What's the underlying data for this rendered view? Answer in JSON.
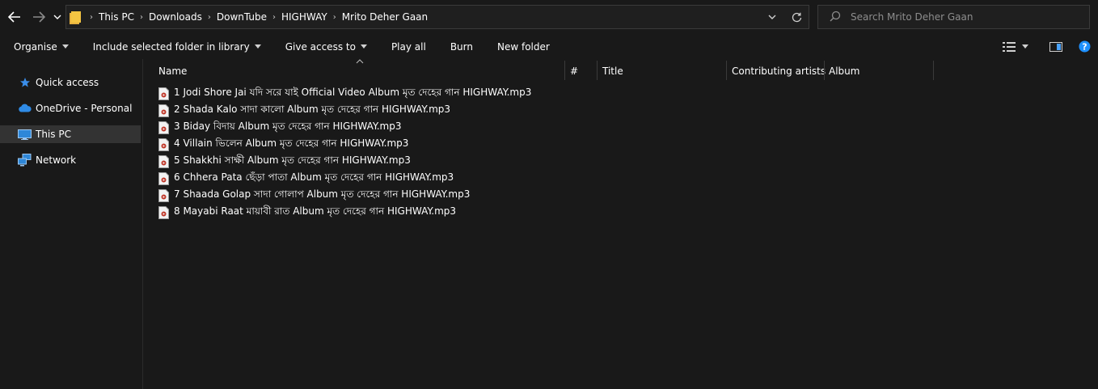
{
  "breadcrumb": [
    "This PC",
    "Downloads",
    "DownTube",
    "HIGHWAY",
    "Mrito Deher Gaan"
  ],
  "search": {
    "placeholder": "Search Mrito Deher Gaan"
  },
  "toolbar": {
    "organise": "Organise",
    "include_library": "Include selected folder in library",
    "give_access": "Give access to",
    "play_all": "Play all",
    "burn": "Burn",
    "new_folder": "New folder"
  },
  "navpane": {
    "items": [
      {
        "label": "Quick access",
        "icon": "star-icon"
      },
      {
        "label": "OneDrive - Personal",
        "icon": "cloud-icon"
      },
      {
        "label": "This PC",
        "icon": "computer-icon",
        "selected": true
      },
      {
        "label": "Network",
        "icon": "network-icon"
      }
    ]
  },
  "columns": [
    "Name",
    "#",
    "Title",
    "Contributing artists",
    "Album"
  ],
  "files": [
    "1 Jodi Shore Jai  যদি সরে যাই  Official Video  Album মৃত দেহের গান  HIGHWAY.mp3",
    "2 Shada Kalo সাদা কালো  Album মৃত দেহের গান  HIGHWAY.mp3",
    "3 Biday বিদায়  Album মৃত দেহের গান  HIGHWAY.mp3",
    "4 Villain ভিলেন  Album মৃত দেহের গান  HIGHWAY.mp3",
    "5 Shakkhi সাক্ষী  Album মৃত দেহের গান  HIGHWAY.mp3",
    "6 Chhera Pata ছেঁড়া পাতা  Album মৃত দেহের গান  HIGHWAY.mp3",
    "7 Shaada Golap সাদা গোলাপ  Album মৃত দেহের গান  HIGHWAY.mp3",
    "8 Mayabi Raat মায়াবী রাত  Album মৃত দেহের গান  HIGHWAY.mp3"
  ],
  "colors": {
    "background": "#191919",
    "selected": "#333333",
    "accent_blue": "#1e90ff",
    "folder_yellow": "#f5c542"
  }
}
